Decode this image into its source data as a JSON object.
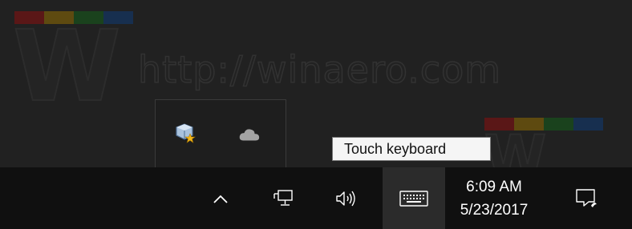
{
  "watermark": {
    "letter": "W",
    "url": "http://winaero.com",
    "colors": [
      "#7a1e1e",
      "#8a6a10",
      "#1f5a24",
      "#1a3f6a"
    ]
  },
  "overflow": {
    "icons": [
      {
        "name": "virtualbox-icon",
        "interactable": true
      },
      {
        "name": "onedrive-cloud-icon",
        "interactable": true
      }
    ]
  },
  "tooltip": {
    "text": "Touch keyboard"
  },
  "tray": {
    "icons": [
      "show-hidden-icons-chevron-icon",
      "network-icon",
      "volume-icon",
      "touch-keyboard-icon",
      "action-center-icon"
    ]
  },
  "clock": {
    "time": "6:09 AM",
    "date": "5/23/2017"
  }
}
